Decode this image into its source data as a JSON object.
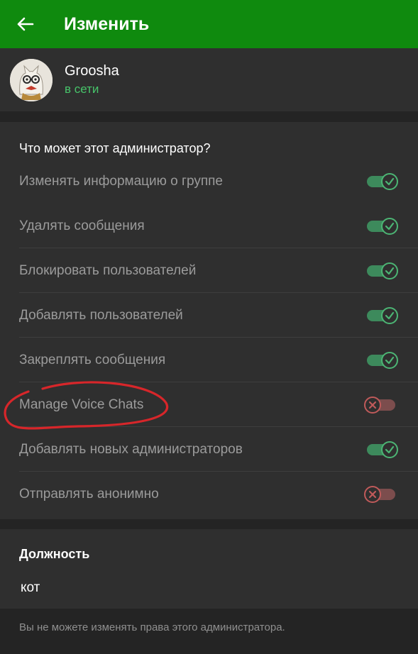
{
  "header": {
    "title": "Изменить",
    "back_icon": "arrow-left-icon",
    "background": "#0f8a0e"
  },
  "user": {
    "name": "Groosha",
    "status": "в сети",
    "status_color": "#47c46a"
  },
  "rights": {
    "title": "Что может этот администратор?",
    "items": [
      {
        "label": "Изменять информацию о группе",
        "enabled": true
      },
      {
        "label": "Удалять сообщения",
        "enabled": true
      },
      {
        "label": "Блокировать пользователей",
        "enabled": true
      },
      {
        "label": "Добавлять пользователей",
        "enabled": true
      },
      {
        "label": "Закреплять сообщения",
        "enabled": true
      },
      {
        "label": "Manage Voice Chats",
        "enabled": false
      },
      {
        "label": "Добавлять новых администраторов",
        "enabled": true
      },
      {
        "label": "Отправлять анонимно",
        "enabled": false
      }
    ]
  },
  "rank": {
    "title": "Должность",
    "value": "кот"
  },
  "footer": {
    "note": "Вы не можете изменять права этого администратора."
  },
  "colors": {
    "toggle_on": "#4cb574",
    "toggle_off": "#c05a5a",
    "annotation": "#d7262a"
  }
}
